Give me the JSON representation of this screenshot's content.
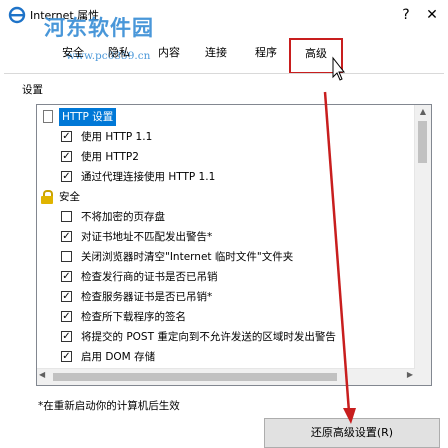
{
  "window": {
    "title": "Internet 属性",
    "help_glyph": "?",
    "close_glyph": "✕"
  },
  "watermark": {
    "text": "河东软件园",
    "url": "www.pc0359.cn"
  },
  "tabs": [
    {
      "label": "安全"
    },
    {
      "label": "隐私"
    },
    {
      "label": "内容"
    },
    {
      "label": "连接"
    },
    {
      "label": "程序"
    },
    {
      "label": "高级",
      "selected": true
    }
  ],
  "settings": {
    "section_label": "设置",
    "groups": [
      {
        "label": "HTTP 设置",
        "icon": "page-icon",
        "items": [
          {
            "label": "使用 HTTP 1.1",
            "checked": true
          },
          {
            "label": "使用 HTTP2",
            "checked": true
          },
          {
            "label": "通过代理连接使用 HTTP 1.1",
            "checked": true
          }
        ]
      },
      {
        "label": "安全",
        "icon": "lock-icon",
        "items": [
          {
            "label": "不将加密的页存盘",
            "checked": false
          },
          {
            "label": "对证书地址不匹配发出警告*",
            "checked": true
          },
          {
            "label": "关闭浏览器时清空\"Internet 临时文件\"文件夹",
            "checked": false
          },
          {
            "label": "检查发行商的证书是否已吊销",
            "checked": true
          },
          {
            "label": "检查服务器证书是否已吊销*",
            "checked": true
          },
          {
            "label": "检查所下载程序的签名",
            "checked": true
          },
          {
            "label": "将提交的 POST 重定向到不允许发送的区域时发出警告",
            "checked": true
          },
          {
            "label": "启用 DOM 存储",
            "checked": true
          }
        ]
      }
    ]
  },
  "footer": {
    "note": "*在重新启动你的计算机后生效",
    "reset_button_label": "还原高级设置(R)"
  },
  "colors": {
    "highlight": "#c81e1e",
    "selection": "#0078d7",
    "watermark": "#3a8fd6"
  }
}
